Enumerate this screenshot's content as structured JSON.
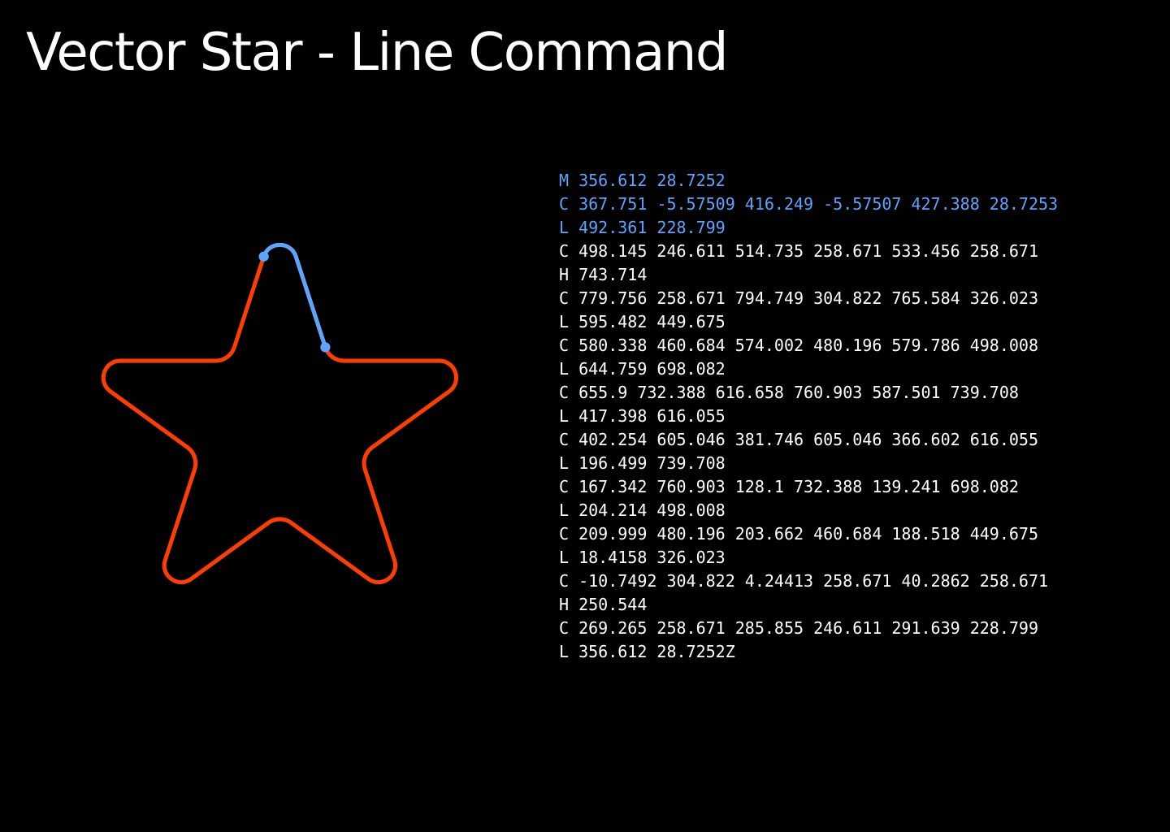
{
  "title": "Vector Star - Line Command",
  "colors": {
    "background": "#000000",
    "title": "#ffffff",
    "star_stroke": "#ff3d00",
    "highlight": "#5ba4ff",
    "command_text": "#ffffff"
  },
  "highlighted_command_count": 3,
  "path_commands": [
    "M 356.612 28.7252",
    "C 367.751 -5.57509 416.249 -5.57507 427.388 28.7253",
    "L 492.361 228.799",
    "C 498.145 246.611 514.735 258.671 533.456 258.671",
    "H 743.714",
    "C 779.756 258.671 794.749 304.822 765.584 326.023",
    "L 595.482 449.675",
    "C 580.338 460.684 574.002 480.196 579.786 498.008",
    "L 644.759 698.082",
    "C 655.9 732.388 616.658 760.903 587.501 739.708",
    "L 417.398 616.055",
    "C 402.254 605.046 381.746 605.046 366.602 616.055",
    "L 196.499 739.708",
    "C 167.342 760.903 128.1 732.388 139.241 698.082",
    "L 204.214 498.008",
    "C 209.999 480.196 203.662 460.684 188.518 449.675",
    "L 18.4158 326.023",
    "C -10.7492 304.822 4.24413 258.671 40.2862 258.671",
    "H 250.544",
    "C 269.265 258.671 285.855 246.611 291.639 228.799",
    "L 356.612 28.7252Z"
  ]
}
